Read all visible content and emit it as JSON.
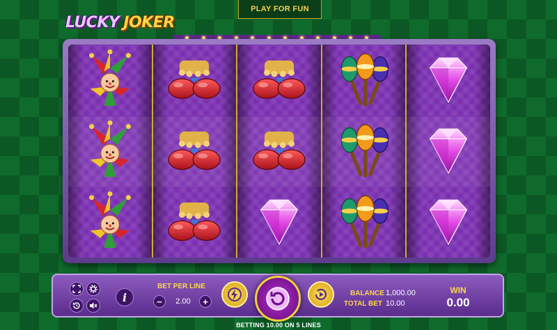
{
  "top": {
    "play_for_fun": "PLAY FOR FUN"
  },
  "logo": {
    "word1": "LUCKY",
    "word2": "JOKER"
  },
  "reels": [
    [
      "jester",
      "jester",
      "jester"
    ],
    [
      "clown-shoes",
      "clown-shoes",
      "clown-shoes"
    ],
    [
      "clown-shoes",
      "clown-shoes",
      "diamond"
    ],
    [
      "maracas",
      "maracas",
      "maracas"
    ],
    [
      "diamond",
      "diamond",
      "diamond"
    ]
  ],
  "controls": {
    "bet_per_line_label": "BET PER LINE",
    "bet_per_line_value": "2.00",
    "minus": "−",
    "plus": "+",
    "info": "i",
    "balance_label": "BALANCE",
    "balance_value": "1,000.00",
    "total_bet_label": "TOTAL BET",
    "total_bet_value": "10.00",
    "win_label": "WIN",
    "win_value": "0.00"
  },
  "status": {
    "betting_text": "BETTING 10.00 ON 5 LINES"
  },
  "colors": {
    "background": "#0f6b2c",
    "reel_purple": "#7a2fb0",
    "gold": "#ffd84a",
    "panel_purple": "#5a2c8c"
  },
  "icons": {
    "fullscreen": "fullscreen-icon",
    "settings": "gear-icon",
    "history": "history-icon",
    "sound": "speaker-mute-icon",
    "turbo": "lightning-icon",
    "spin": "spin-icon",
    "autoplay": "autoplay-icon"
  }
}
